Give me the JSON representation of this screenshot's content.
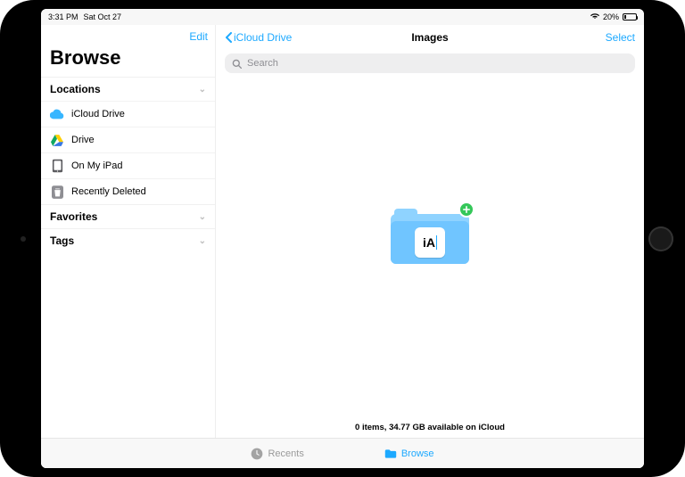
{
  "status": {
    "time": "3:31 PM",
    "date": "Sat Oct 27",
    "battery_pct_label": "20%",
    "battery_pct": 20
  },
  "sidebar": {
    "edit_label": "Edit",
    "title": "Browse",
    "sections": {
      "locations": {
        "label": "Locations"
      },
      "favorites": {
        "label": "Favorites"
      },
      "tags": {
        "label": "Tags"
      }
    },
    "locations": [
      {
        "icon": "icloud-icon",
        "label": "iCloud Drive"
      },
      {
        "icon": "gdrive-icon",
        "label": "Drive"
      },
      {
        "icon": "ipad-icon",
        "label": "On My iPad"
      },
      {
        "icon": "trash-icon",
        "label": "Recently Deleted"
      }
    ]
  },
  "content": {
    "back_label": "iCloud Drive",
    "title": "Images",
    "select_label": "Select",
    "search_placeholder": "Search",
    "drop_app_label": "iA",
    "footer_status": "0 items, 34.77 GB available on iCloud"
  },
  "tabbar": {
    "recents": "Recents",
    "browse": "Browse"
  }
}
